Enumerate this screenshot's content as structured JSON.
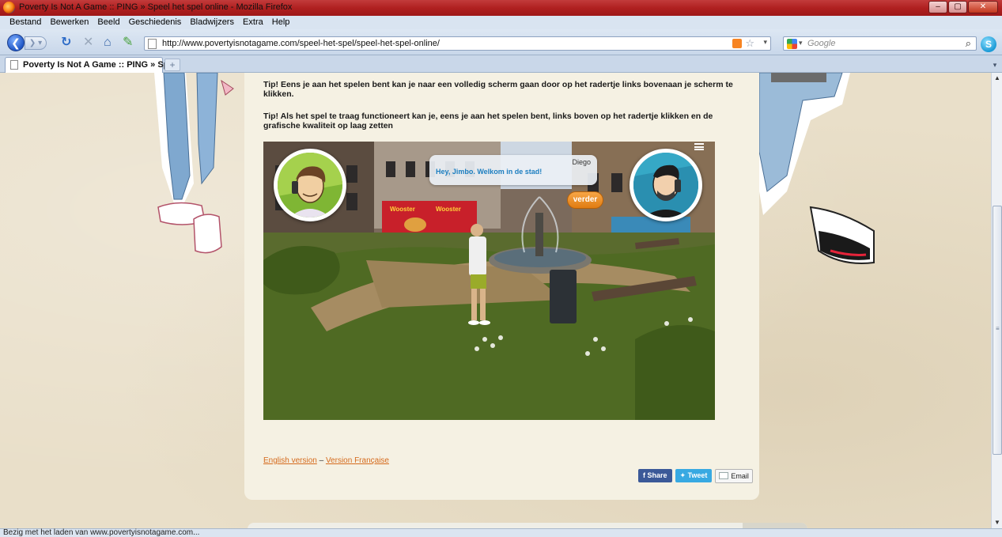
{
  "window": {
    "title": "Poverty Is Not A Game :: PING » Speel het spel online - Mozilla Firefox",
    "buttons": {
      "minimize": "–",
      "maximize": "▢",
      "close": "✕"
    }
  },
  "menu": [
    "Bestand",
    "Bewerken",
    "Beeld",
    "Geschiedenis",
    "Bladwijzers",
    "Extra",
    "Help"
  ],
  "nav": {
    "url": "http://www.povertyisnotagame.com/speel-het-spel/speel-het-spel-online/",
    "search_placeholder": "Google"
  },
  "tabs": [
    {
      "label": "Poverty Is Not A Game :: PING » Spe..."
    }
  ],
  "status": "Bezig met het laden van www.povertyisnotagame.com...",
  "page": {
    "tip1": "Tip! Eens je aan het spelen bent kan je naar een volledig scherm gaan door op het radertje links bovenaan je scherm te klikken.",
    "tip2": "Tip! Als het spel te traag functioneert kan je, eens je aan het spelen bent, links boven op het radertje klikken en de grafische kwaliteit op laag zetten",
    "game": {
      "speaker": "Diego",
      "dialog": "Hey, Jimbo. Welkom in de stad!",
      "continue_label": "verder",
      "shop_sign": "Wooster"
    },
    "links": {
      "english": "English version",
      "separator": " – ",
      "french": "Version Française"
    },
    "share": {
      "facebook": "Share",
      "twitter": "Tweet",
      "email": "Email"
    }
  },
  "icons": [
    "firefox-icon",
    "back-icon",
    "forward-icon",
    "reload-icon",
    "stop-icon",
    "home-icon",
    "bookmark-icon",
    "page-icon",
    "rss-icon",
    "star-icon",
    "google-icon",
    "search-icon",
    "skype-icon"
  ]
}
